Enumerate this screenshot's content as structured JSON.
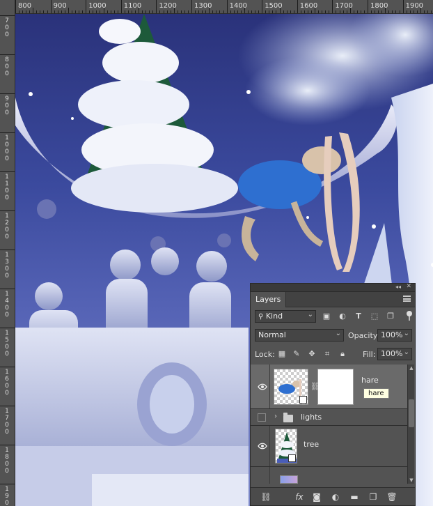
{
  "ruler": {
    "top_labels": [
      "800",
      "900",
      "1000",
      "1100",
      "1200",
      "1300",
      "1400",
      "1500",
      "1600",
      "1700",
      "1800",
      "1900"
    ],
    "left_labels": [
      "700",
      "800",
      "900",
      "1000",
      "1100",
      "1200",
      "1300",
      "1400",
      "1500",
      "1600",
      "1700",
      "1800",
      "1900"
    ]
  },
  "layers_panel": {
    "tab_title": "Layers",
    "filter": {
      "kind_value": "Kind"
    },
    "blend_mode": "Normal",
    "opacity": {
      "label": "Opacity:",
      "value": "100%"
    },
    "lock_label": "Lock:",
    "fill": {
      "label": "Fill:",
      "value": "100%"
    },
    "layers": [
      {
        "name": "hare",
        "tooltip": "hare",
        "visible": true,
        "selected": true,
        "type": "smart-object-with-mask"
      },
      {
        "name": "lights",
        "visible": false,
        "selected": false,
        "type": "group"
      },
      {
        "name": "tree",
        "visible": true,
        "selected": false,
        "type": "smart-object"
      }
    ],
    "footer_icons": [
      "link-icon",
      "fx-icon",
      "add-mask-icon",
      "adjustment-icon",
      "new-group-icon",
      "new-layer-icon",
      "trash-icon"
    ]
  },
  "colors": {
    "panel_bg": "#535353",
    "selected_row": "#6a6a6a",
    "ruler_bg": "#535353",
    "sky": "#3b4a9e"
  }
}
